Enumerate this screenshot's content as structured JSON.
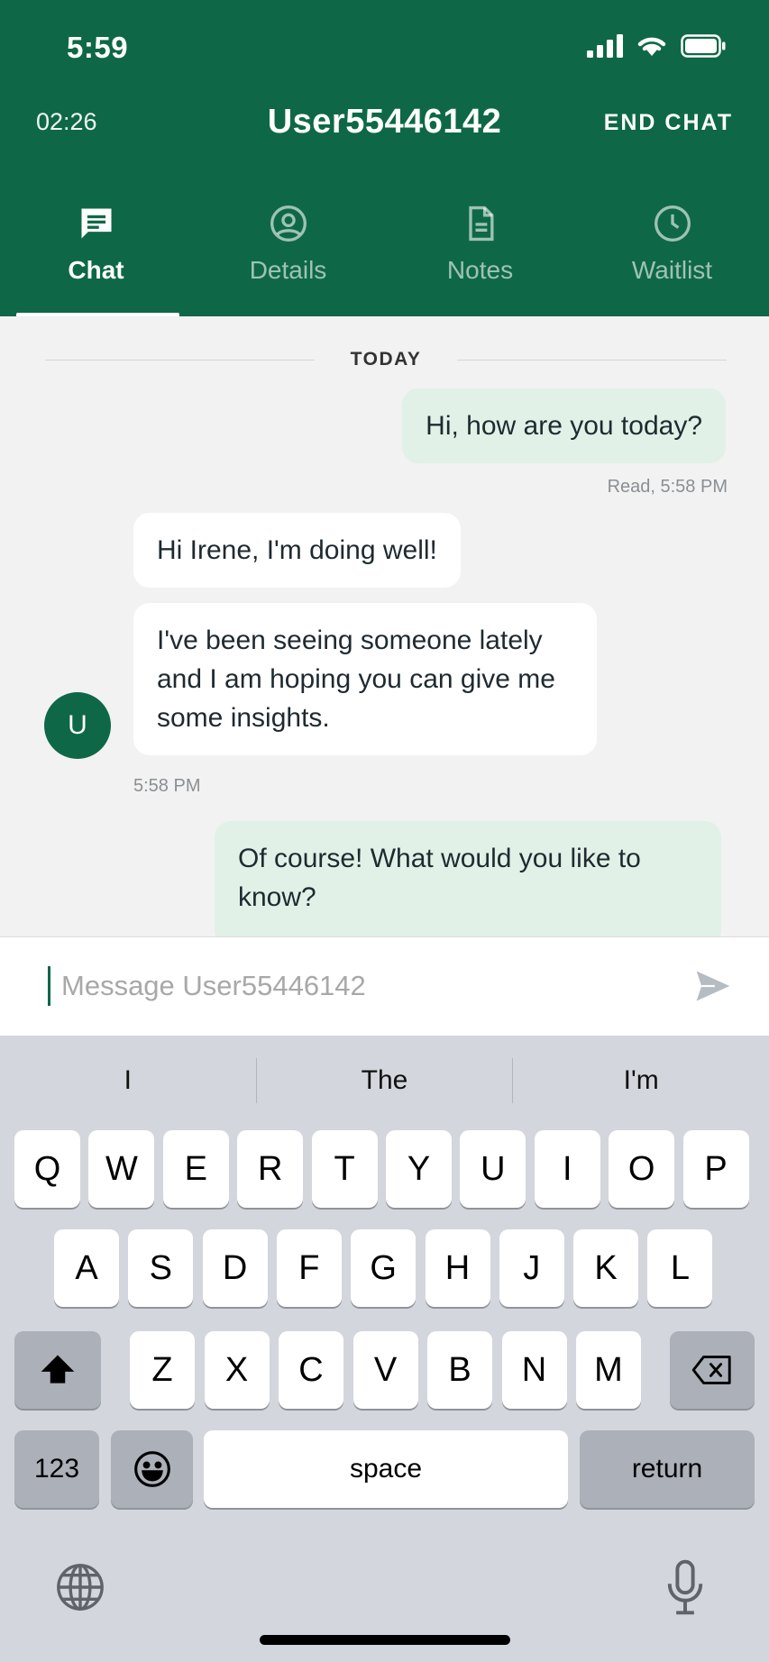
{
  "status_bar": {
    "time": "5:59"
  },
  "header": {
    "timer": "02:26",
    "title": "User55446142",
    "end_chat": "END CHAT"
  },
  "tabs": [
    {
      "label": "Chat",
      "icon": "chat-icon",
      "active": true
    },
    {
      "label": "Details",
      "icon": "person-circle-icon",
      "active": false
    },
    {
      "label": "Notes",
      "icon": "document-icon",
      "active": false
    },
    {
      "label": "Waitlist",
      "icon": "clock-icon",
      "active": false
    }
  ],
  "chat": {
    "day_label": "TODAY",
    "messages": [
      {
        "text": "Hi, how are you today?",
        "direction": "out"
      },
      {
        "text": "Hi Irene, I'm doing well!",
        "direction": "in"
      },
      {
        "text": "I've been seeing someone lately and I am hoping you can give me some insights.",
        "direction": "in"
      },
      {
        "text": "Of course! What would you like to know?",
        "direction": "out"
      }
    ],
    "read_receipt": "Read, 5:58 PM",
    "incoming_time": "5:58 PM",
    "avatar_initial": "U"
  },
  "composer": {
    "placeholder": "Message User55446142"
  },
  "keyboard": {
    "suggestions": [
      "I",
      "The",
      "I'm"
    ],
    "row1": [
      "Q",
      "W",
      "E",
      "R",
      "T",
      "Y",
      "U",
      "I",
      "O",
      "P"
    ],
    "row2": [
      "A",
      "S",
      "D",
      "F",
      "G",
      "H",
      "J",
      "K",
      "L"
    ],
    "row3": [
      "Z",
      "X",
      "C",
      "V",
      "B",
      "N",
      "M"
    ],
    "numbers_label": "123",
    "space_label": "space",
    "return_label": "return"
  },
  "colors": {
    "brand": "#0e6847",
    "outgoing_bubble": "#e1f1e7"
  }
}
